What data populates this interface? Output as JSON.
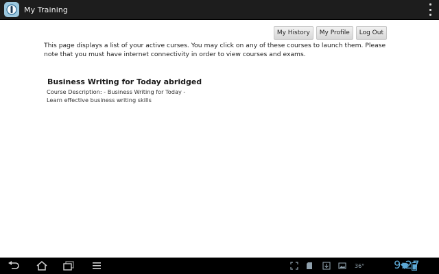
{
  "app": {
    "title": "My Training",
    "icon": "info-icon"
  },
  "toolbar": {
    "my_history": "My History",
    "my_profile": "My Profile",
    "log_out": "Log Out"
  },
  "intro": "This page displays a list of your active curses. You may click on any of these courses to launch them. Please note that you must have internet connectivity in order to view courses and exams.",
  "courses": [
    {
      "title": "Business Writing for Today abridged",
      "description_line1": "Course Description: - Business Writing for Today -",
      "description_line2": "Learn effective business writing skills"
    }
  ],
  "system_bar": {
    "temperature": "36°",
    "time": "9:27",
    "nav_icons": [
      "back-icon",
      "home-icon",
      "recent-apps-icon",
      "menu-icon"
    ],
    "status_icons": [
      "screenshot-icon",
      "sd-card-icon",
      "download-icon",
      "image-icon",
      "wifi-icon",
      "battery-icon"
    ]
  },
  "colors": {
    "action_bar": "#1d1d1d",
    "clock": "#5da9d6",
    "button": "#e4e4e4"
  }
}
